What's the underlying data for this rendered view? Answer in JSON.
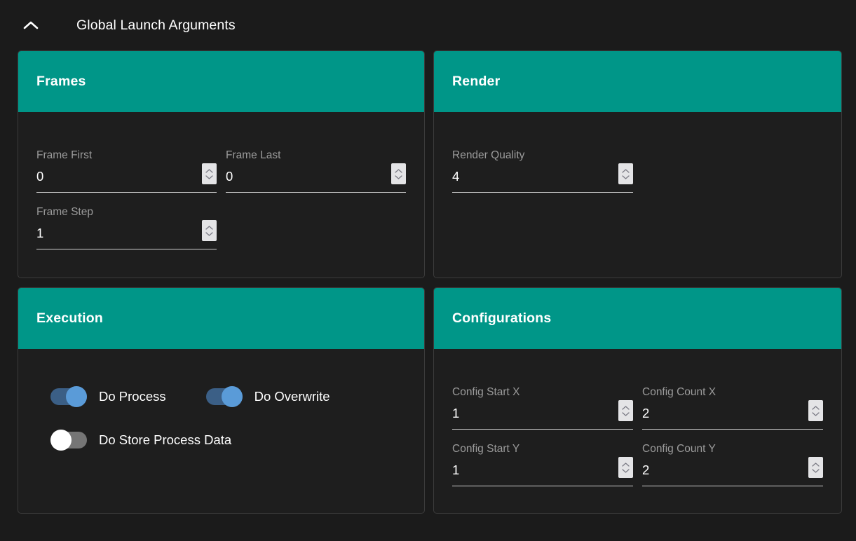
{
  "header": {
    "title": "Global Launch Arguments",
    "collapse_icon": "chevron-up-icon"
  },
  "theme": {
    "accent": "#009688",
    "panel_bg": "#1e1e1e",
    "page_bg": "#1b1b1b",
    "label_color": "#9b9b9b",
    "value_color": "#ffffff",
    "toggle_on_track": "#3b5f86",
    "toggle_on_knob": "#5a9bd8",
    "toggle_off_track": "#757575",
    "toggle_off_knob": "#ffffff",
    "spinner_bg": "#e4e4e6"
  },
  "panels": {
    "frames": {
      "title": "Frames",
      "fields": {
        "frame_first": {
          "label": "Frame First",
          "value": "0"
        },
        "frame_last": {
          "label": "Frame Last",
          "value": "0"
        },
        "frame_step": {
          "label": "Frame Step",
          "value": "1"
        }
      }
    },
    "render": {
      "title": "Render",
      "fields": {
        "render_quality": {
          "label": "Render Quality",
          "value": "4"
        }
      }
    },
    "execution": {
      "title": "Execution",
      "toggles": {
        "do_process": {
          "label": "Do Process",
          "state": "on"
        },
        "do_overwrite": {
          "label": "Do Overwrite",
          "state": "on"
        },
        "do_store_process_data": {
          "label": "Do Store Process Data",
          "state": "off"
        }
      }
    },
    "configurations": {
      "title": "Configurations",
      "fields": {
        "config_start_x": {
          "label": "Config Start X",
          "value": "1"
        },
        "config_count_x": {
          "label": "Config Count X",
          "value": "2"
        },
        "config_start_y": {
          "label": "Config Start Y",
          "value": "1"
        },
        "config_count_y": {
          "label": "Config Count Y",
          "value": "2"
        }
      }
    }
  }
}
